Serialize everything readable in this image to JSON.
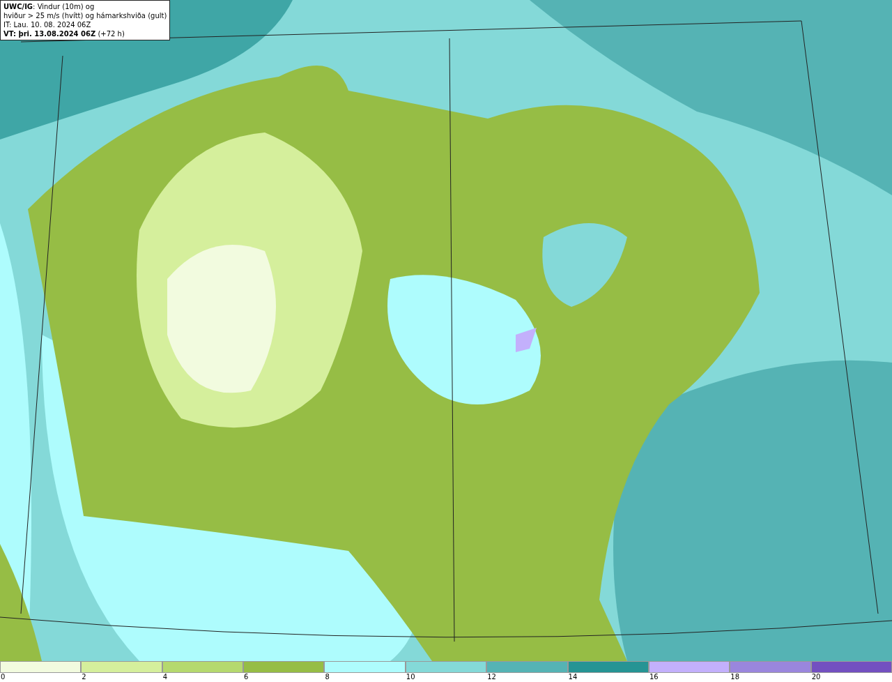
{
  "info_box": {
    "lines": [
      "**UWC/IG**: Vindur (10m) og",
      "hviður > 25 m/s (hvítt) og hámarkshviða (gult)",
      "IT: Lau. 10. 08. 2024 06Z",
      "**VT: þri. 13.08.2024 06Z** (+72 h)"
    ]
  },
  "legend": {
    "bins": [
      {
        "color": "#f2fbdf",
        "label": "0"
      },
      {
        "color": "#d5ef9c",
        "label": "2"
      },
      {
        "color": "#b5d96e",
        "label": "4"
      },
      {
        "color": "#96bd45",
        "label": "6"
      },
      {
        "color": "#aefcfd",
        "label": "8"
      },
      {
        "color": "#84d9d8",
        "label": "10"
      },
      {
        "color": "#55b3b4",
        "label": "12"
      },
      {
        "color": "#269494",
        "label": "14"
      },
      {
        "color": "#c3b0fc",
        "label": "16"
      },
      {
        "color": "#9a86dd",
        "label": "18"
      },
      {
        "color": "#7350c0",
        "label": "20"
      }
    ]
  }
}
